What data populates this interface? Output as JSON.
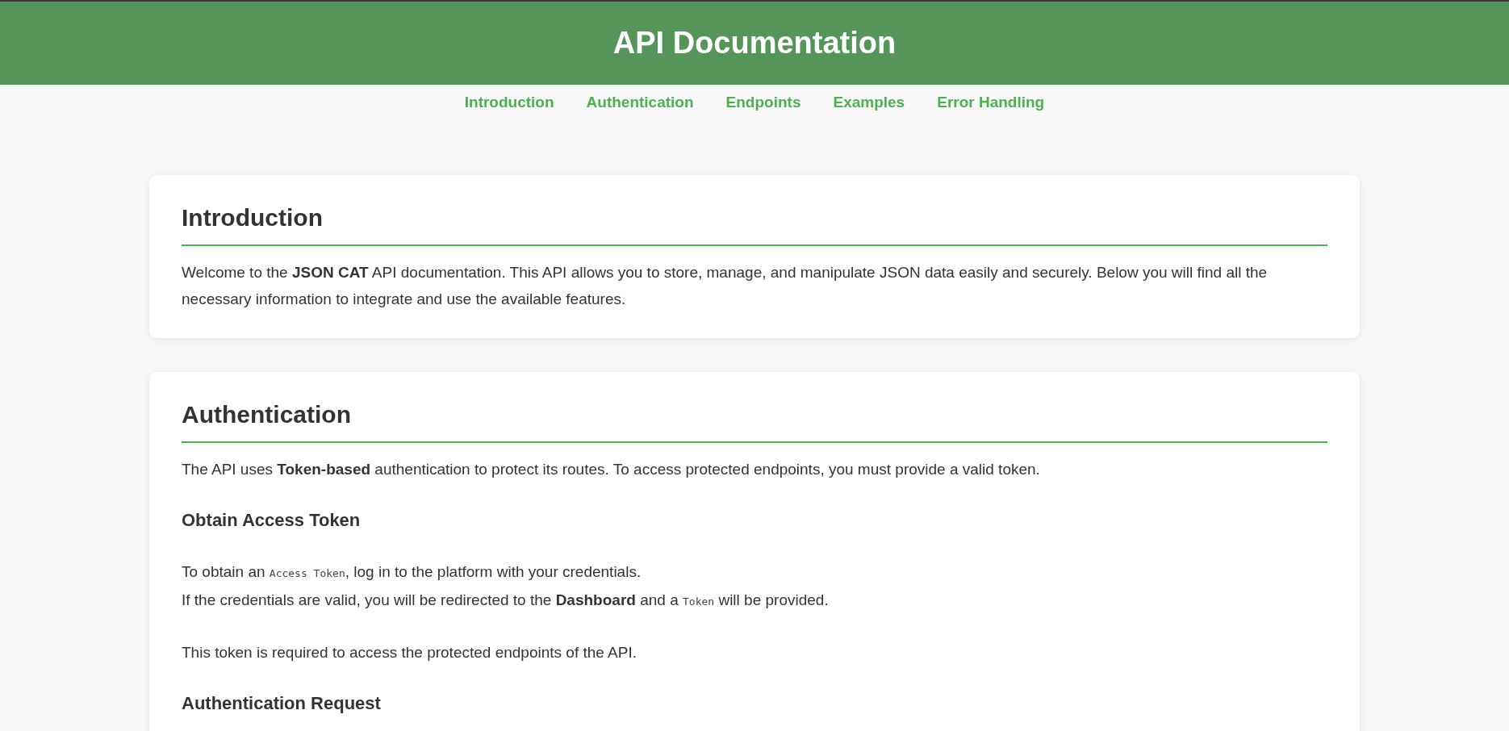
{
  "header": {
    "title": "API Documentation"
  },
  "nav": [
    "Introduction",
    "Authentication",
    "Endpoints",
    "Examples",
    "Error Handling"
  ],
  "sections": [
    {
      "title": "Introduction",
      "blocks": [
        {
          "kind": "paragraph",
          "lines": [
            [
              {
                "kind": "text",
                "text": "Welcome to the **JSON CAT** API documentation. This API allows you to store, manage, and manipulate JSON data easily and securely. Below you will find all the necessary information to integrate and use the available features."
              }
            ]
          ]
        }
      ]
    },
    {
      "title": "Authentication",
      "blocks": [
        {
          "kind": "paragraph",
          "lines": [
            [
              {
                "kind": "text",
                "text": "The API uses **Token-based** authentication to protect its routes. To access protected endpoints, you must provide a valid token."
              }
            ]
          ]
        },
        {
          "kind": "subheading",
          "text": "Obtain Access Token"
        },
        {
          "kind": "paragraph",
          "lines": [
            [
              {
                "kind": "text",
                "text": "To obtain an "
              },
              {
                "kind": "code",
                "text": "Access Token"
              },
              {
                "kind": "text",
                "text": ", log in to the platform with your credentials."
              }
            ],
            [
              {
                "kind": "text",
                "text": "If the credentials are valid, you will be redirected to the **Dashboard** and a "
              },
              {
                "kind": "code",
                "text": "Token"
              },
              {
                "kind": "text",
                "text": " will be provided."
              }
            ]
          ]
        },
        {
          "kind": "paragraph",
          "lines": [
            [
              {
                "kind": "text",
                "text": "This token is required to access the protected endpoints of the API."
              }
            ]
          ]
        },
        {
          "kind": "subheading",
          "text": "Authentication Request"
        }
      ]
    }
  ]
}
